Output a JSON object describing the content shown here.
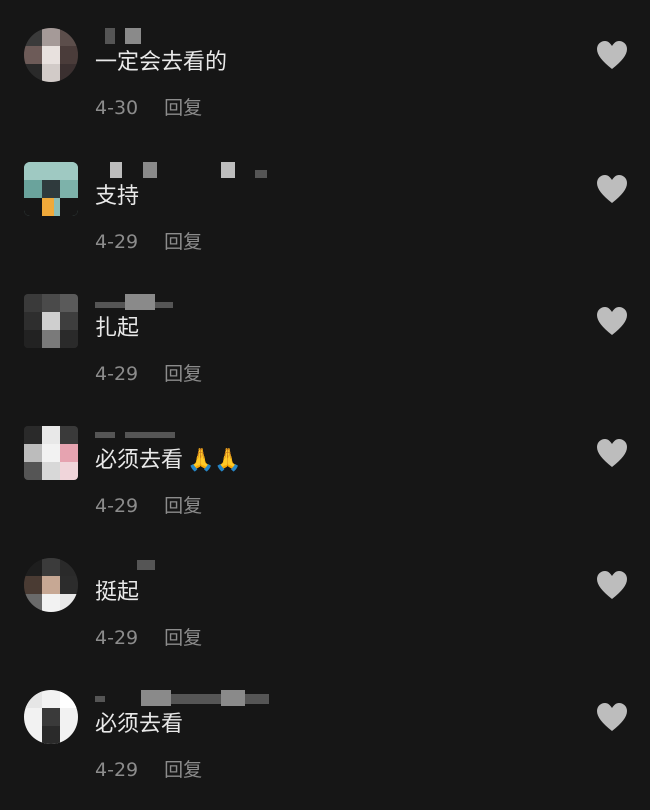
{
  "reply_label": "回复",
  "icons": {
    "like": "heart-icon",
    "emoji": "folded-hands-emoji"
  },
  "colors": {
    "background": "#161616",
    "text": "#e9e9e9",
    "meta": "#8c8c8c",
    "heart": "#bdbdbd"
  },
  "comments": [
    {
      "text": "一定会去看的",
      "date": "4-30",
      "reply": "回复"
    },
    {
      "text": "支持",
      "date": "4-29",
      "reply": "回复"
    },
    {
      "text": "扎起",
      "date": "4-29",
      "reply": "回复"
    },
    {
      "text": "必须去看",
      "emoji": "🙏🙏",
      "date": "4-29",
      "reply": "回复"
    },
    {
      "text": "挺起",
      "date": "4-29",
      "reply": "回复"
    },
    {
      "text": "必须去看",
      "date": "4-29",
      "reply": "回复"
    }
  ]
}
